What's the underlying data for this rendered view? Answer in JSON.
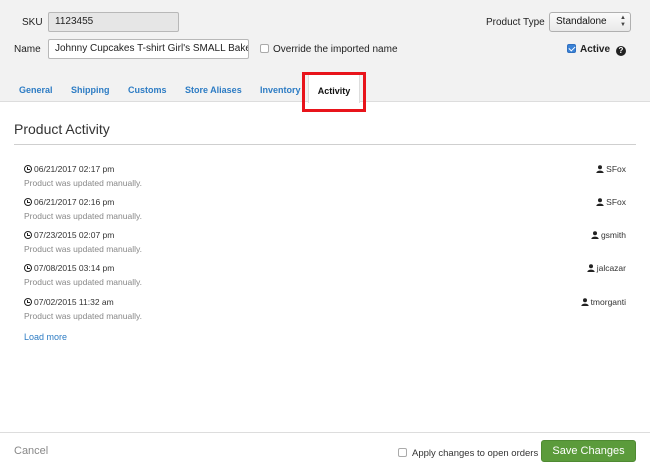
{
  "header": {
    "sku_label": "SKU",
    "sku_value": "1123455",
    "name_label": "Name",
    "name_value": "Johnny Cupcakes T-shirt Girl's SMALL Bake & Ta",
    "override_label": "Override the imported name",
    "override_checked": false,
    "product_type_label": "Product Type",
    "product_type_value": "Standalone",
    "active_label": "Active",
    "active_checked": true
  },
  "tabs": [
    {
      "label": "General"
    },
    {
      "label": "Shipping"
    },
    {
      "label": "Customs"
    },
    {
      "label": "Store Aliases"
    },
    {
      "label": "Inventory"
    },
    {
      "label": "Activity",
      "active": true
    }
  ],
  "activity": {
    "title": "Product Activity",
    "entries": [
      {
        "timestamp": "06/21/2017 02:17 pm",
        "description": "Product was updated manually.",
        "user": "SFox"
      },
      {
        "timestamp": "06/21/2017 02:16 pm",
        "description": "Product was updated manually.",
        "user": "SFox"
      },
      {
        "timestamp": "07/23/2015 02:07 pm",
        "description": "Product was updated manually.",
        "user": "gsmith"
      },
      {
        "timestamp": "07/08/2015 03:14 pm",
        "description": "Product was updated manually.",
        "user": "jalcazar"
      },
      {
        "timestamp": "07/02/2015 11:32 am",
        "description": "Product was updated manually.",
        "user": "tmorganti"
      }
    ],
    "load_more_label": "Load more"
  },
  "footer": {
    "cancel_label": "Cancel",
    "apply_label": "Apply changes to open orders",
    "apply_checked": false,
    "save_label": "Save Changes"
  },
  "colors": {
    "link": "#2d7cc4",
    "save_button": "#5b9b3b",
    "highlight": "#e8141b"
  }
}
